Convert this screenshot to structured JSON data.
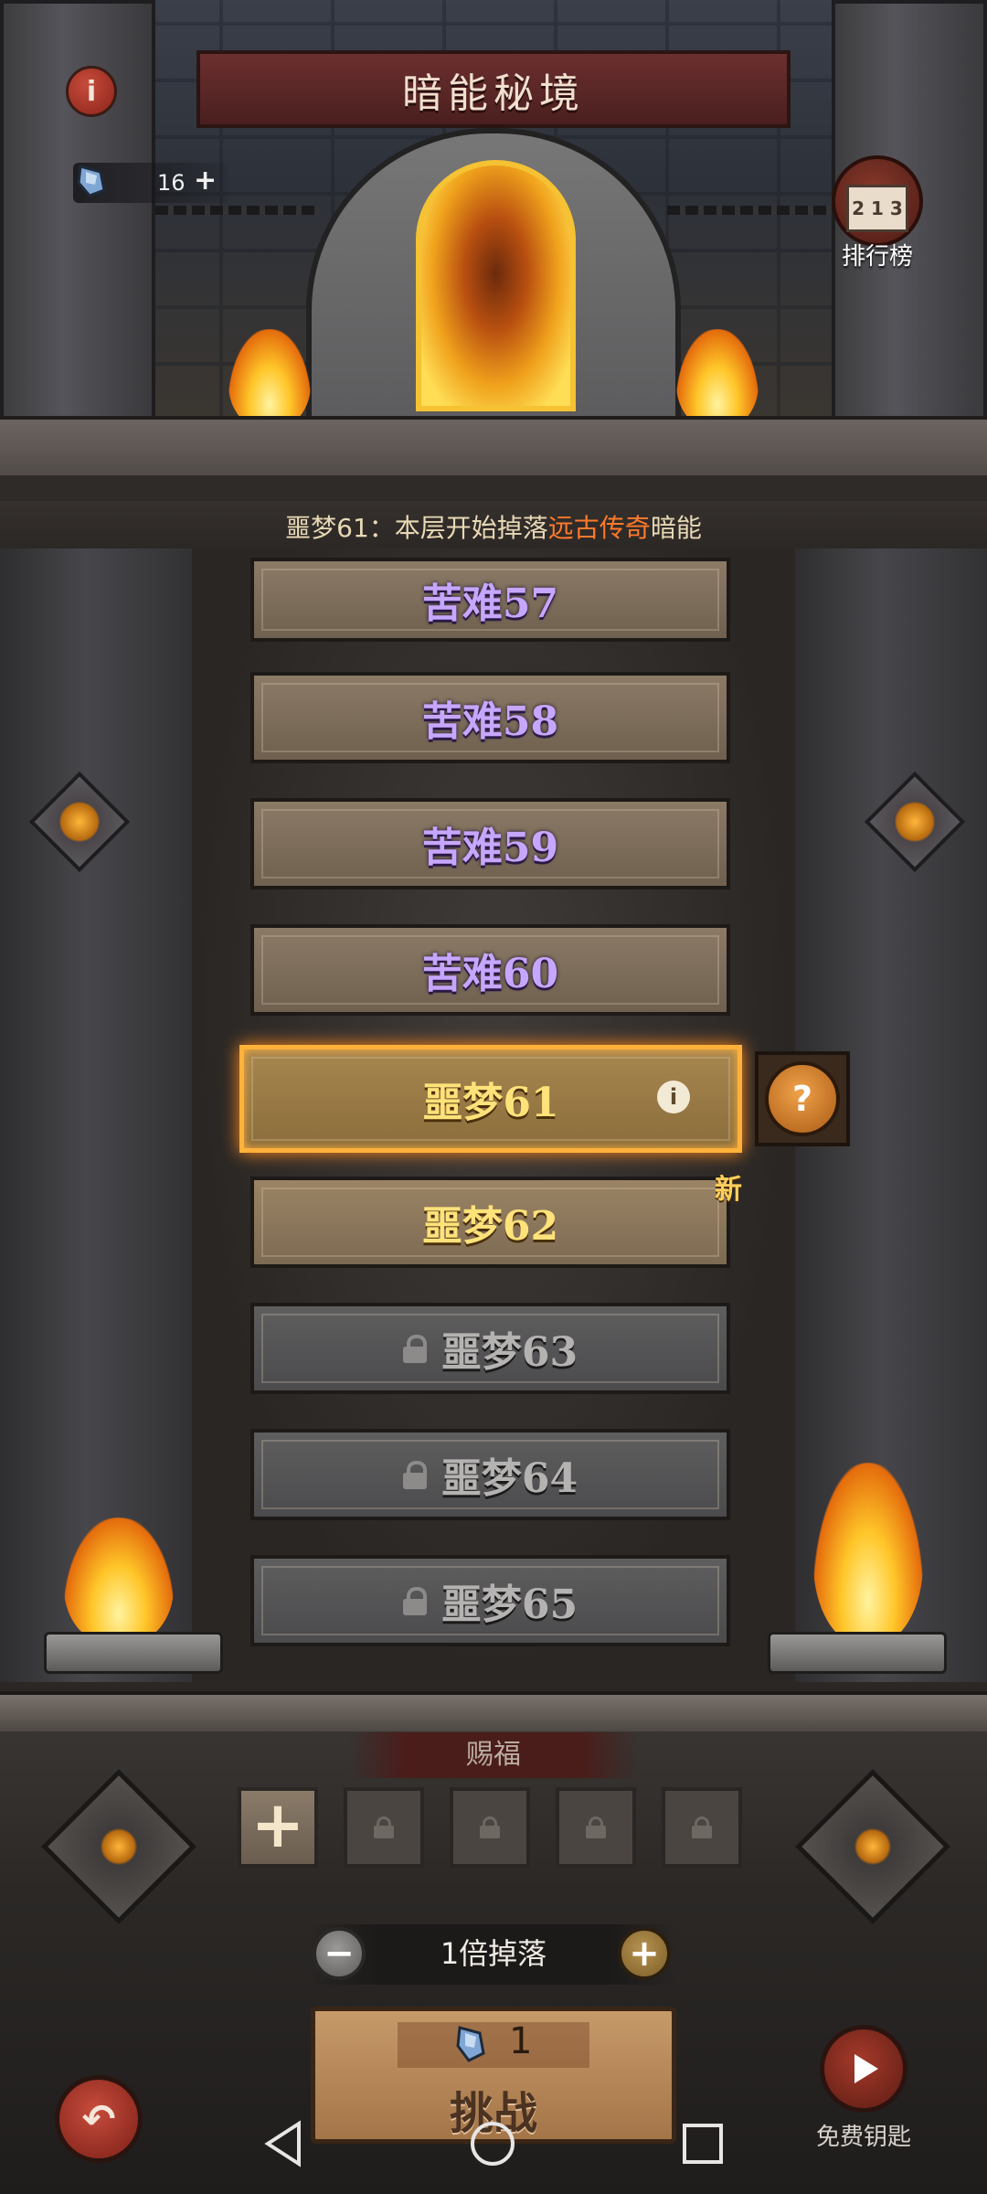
{
  "header": {
    "title": "暗能秘境",
    "info_icon": "info-icon",
    "key_count": "16",
    "key_plus": "+",
    "leaderboard_label": "排行榜",
    "leaderboard_podium": "2 1 3"
  },
  "hint": {
    "prefix": "噩梦61：本层开始掉落",
    "highlight": "远古传奇",
    "suffix": "暗能",
    "highlight_color": "#ff7a2b"
  },
  "levels": [
    {
      "label": "苦难57",
      "style": "purple"
    },
    {
      "label": "苦难58",
      "style": "purple"
    },
    {
      "label": "苦难59",
      "style": "purple"
    },
    {
      "label": "苦难60",
      "style": "purple"
    },
    {
      "label": "噩梦61",
      "style": "gold",
      "selected": true
    },
    {
      "label": "噩梦62",
      "style": "gold",
      "new": true
    },
    {
      "label": "噩梦63",
      "style": "locked"
    },
    {
      "label": "噩梦64",
      "style": "locked"
    },
    {
      "label": "噩梦65",
      "style": "locked"
    }
  ],
  "level_info_icon": "i",
  "question_button": "?",
  "new_tag": "新",
  "blessing": {
    "title": "赐福",
    "add_label": "+",
    "locked_slots": 4
  },
  "drop": {
    "minus": "−",
    "label": "1倍掉落",
    "plus": "+"
  },
  "challenge": {
    "cost": "1",
    "label": "挑战"
  },
  "free_key_label": "免费钥匙",
  "colors": {
    "purple_text": "#c7a6ff",
    "gold_text": "#ffe27a",
    "selected_border": "#ffb13a"
  }
}
